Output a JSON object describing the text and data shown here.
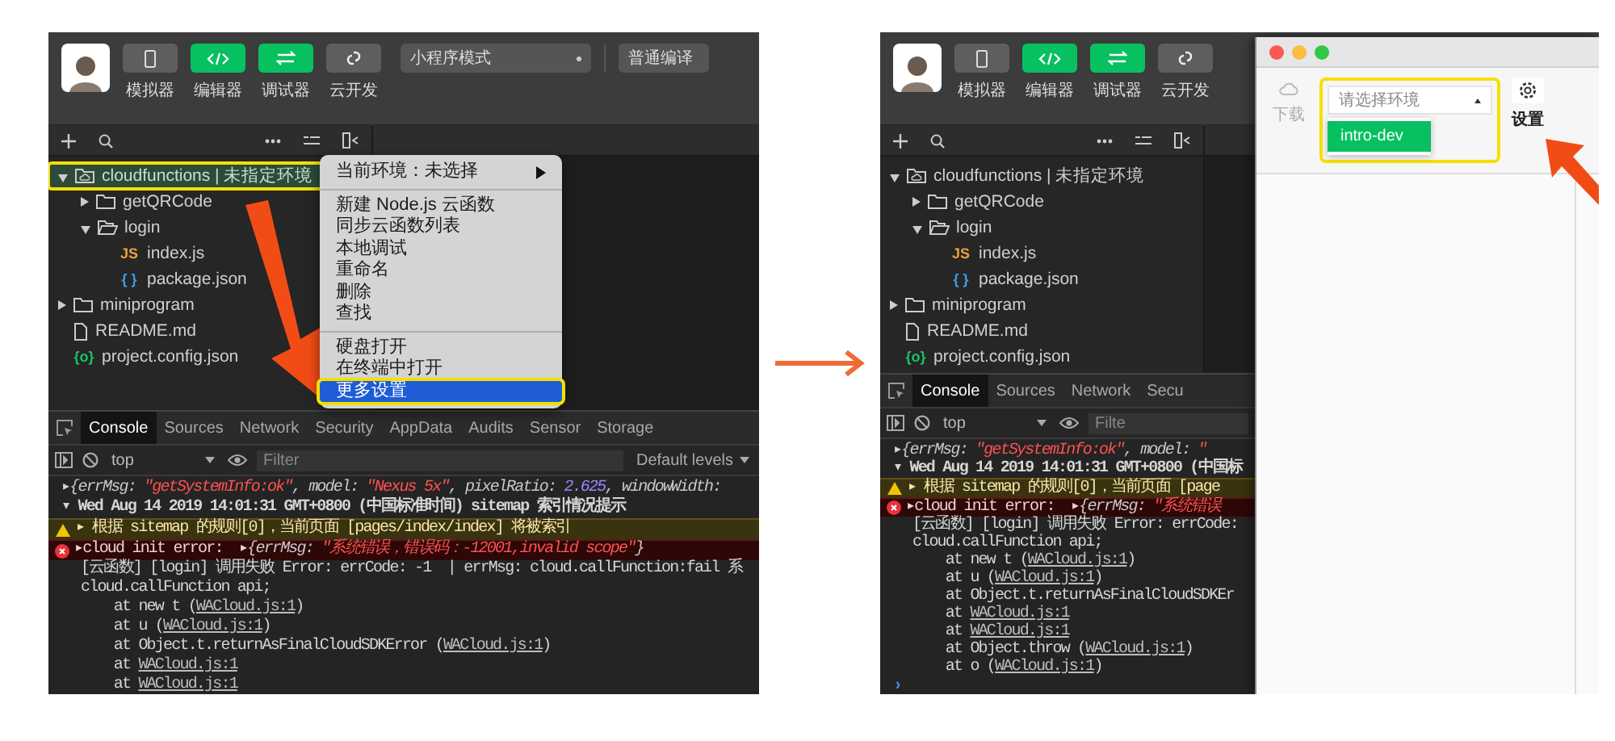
{
  "left_screen": {
    "toolbar": {
      "tools": [
        {
          "label": "模拟器",
          "selected": false
        },
        {
          "label": "编辑器",
          "selected": true
        },
        {
          "label": "调试器",
          "selected": true
        },
        {
          "label": "云开发",
          "selected": false
        }
      ],
      "mode_select": "小程序模式",
      "compile_select": "普通编译"
    },
    "file_tree": [
      {
        "name": "cloudfunctions | 未指定环境",
        "kind": "cloud-folder",
        "expanded": true,
        "selected": true,
        "highlighted": true,
        "children": [
          {
            "name": "getQRCode",
            "kind": "folder",
            "expanded": false,
            "selected": false,
            "highlighted": false
          },
          {
            "name": "login",
            "kind": "folder",
            "expanded": true,
            "selected": false,
            "highlighted": false,
            "children": [
              {
                "name": "index.js",
                "kind": "js",
                "badge": "JS",
                "selected": false,
                "highlighted": false
              },
              {
                "name": "package.json",
                "kind": "json",
                "badge": "{ }",
                "selected": false,
                "highlighted": false
              }
            ]
          }
        ]
      },
      {
        "name": "miniprogram",
        "kind": "folder",
        "expanded": false,
        "selected": false,
        "highlighted": false
      },
      {
        "name": "README.md",
        "kind": "file",
        "selected": false,
        "highlighted": false
      },
      {
        "name": "project.config.json",
        "kind": "config",
        "badge": "{o}",
        "selected": false,
        "highlighted": false
      }
    ],
    "context_menu": {
      "groups": [
        [
          {
            "label": "当前环境：未选择",
            "submenu": true,
            "selected": false,
            "highlighted": false
          }
        ],
        [
          {
            "label": "新建 Node.js 云函数",
            "submenu": false,
            "selected": false,
            "highlighted": false
          },
          {
            "label": "同步云函数列表",
            "submenu": false,
            "selected": false,
            "highlighted": false
          },
          {
            "label": "本地调试",
            "submenu": false,
            "selected": false,
            "highlighted": false
          },
          {
            "label": "重命名",
            "submenu": false,
            "selected": false,
            "highlighted": false
          },
          {
            "label": "删除",
            "submenu": false,
            "selected": false,
            "highlighted": false
          },
          {
            "label": "查找",
            "submenu": false,
            "selected": false,
            "highlighted": false
          }
        ],
        [
          {
            "label": "硬盘打开",
            "submenu": false,
            "selected": false,
            "highlighted": false
          },
          {
            "label": "在终端中打开",
            "submenu": false,
            "selected": false,
            "highlighted": false
          },
          {
            "label": "更多设置",
            "submenu": false,
            "selected": true,
            "highlighted": true
          }
        ]
      ]
    },
    "devtools": {
      "tabs": [
        {
          "label": "Console",
          "selected": true
        },
        {
          "label": "Sources",
          "selected": false
        },
        {
          "label": "Network",
          "selected": false
        },
        {
          "label": "Security",
          "selected": false
        },
        {
          "label": "AppData",
          "selected": false
        },
        {
          "label": "Audits",
          "selected": false
        },
        {
          "label": "Sensor",
          "selected": false
        },
        {
          "label": "Storage",
          "selected": false
        }
      ],
      "context": "top",
      "filter_placeholder": "Filter",
      "levels": "Default levels",
      "console": [
        {
          "kind": "log",
          "parts": [
            {
              "text": "▸",
              "kind": "plain"
            },
            {
              "text": "{errMsg: ",
              "kind": "italic"
            },
            {
              "text": "\"getSystemInfo:ok\"",
              "kind": "string"
            },
            {
              "text": ", model: ",
              "kind": "italic"
            },
            {
              "text": "\"Nexus 5x\"",
              "kind": "string"
            },
            {
              "text": ", pixelRatio: ",
              "kind": "italic"
            },
            {
              "text": "2.625",
              "kind": "number"
            },
            {
              "text": ", windowWidth:",
              "kind": "italic"
            }
          ]
        },
        {
          "kind": "group",
          "parts": [
            {
              "text": "▾ Wed Aug 14 2019 14:01:31 GMT+0800 (中国标准时间) sitemap 索引情况提示",
              "kind": "plain"
            }
          ]
        },
        {
          "kind": "warning",
          "parts": [
            {
              "text": "▸ 根据 sitemap 的规则[0]，当前页面 [pages/index/index] 将被索引",
              "kind": "plain"
            }
          ]
        },
        {
          "kind": "error",
          "parts": [
            {
              "text": "▸cloud init error:  ▸",
              "kind": "plain"
            },
            {
              "text": "{errMsg: ",
              "kind": "italic"
            },
            {
              "text": "\"系统错误，错误码：-12001,invalid scope\"",
              "kind": "string"
            },
            {
              "text": "}",
              "kind": "italic"
            }
          ]
        },
        {
          "kind": "trace",
          "parts": [
            {
              "text": "[云函数] [login] 调用失败 Error: errCode: -1  | errMsg: cloud.callFunction:fail 系",
              "kind": "plain"
            }
          ]
        },
        {
          "kind": "trace",
          "parts": [
            {
              "text": "cloud.callFunction api;",
              "kind": "plain"
            }
          ]
        },
        {
          "kind": "trace",
          "parts": [
            {
              "text": "    at new t (",
              "kind": "plain"
            },
            {
              "text": "WACloud.js:1",
              "kind": "link"
            },
            {
              "text": ")",
              "kind": "plain"
            }
          ]
        },
        {
          "kind": "trace",
          "parts": [
            {
              "text": "    at u (",
              "kind": "plain"
            },
            {
              "text": "WACloud.js:1",
              "kind": "link"
            },
            {
              "text": ")",
              "kind": "plain"
            }
          ]
        },
        {
          "kind": "trace",
          "parts": [
            {
              "text": "    at Object.t.returnAsFinalCloudSDKError (",
              "kind": "plain"
            },
            {
              "text": "WACloud.js:1",
              "kind": "link"
            },
            {
              "text": ")",
              "kind": "plain"
            }
          ]
        },
        {
          "kind": "trace",
          "parts": [
            {
              "text": "    at ",
              "kind": "plain"
            },
            {
              "text": "WACloud.js:1",
              "kind": "link"
            }
          ]
        },
        {
          "kind": "trace",
          "parts": [
            {
              "text": "    at ",
              "kind": "plain"
            },
            {
              "text": "WACloud.js:1",
              "kind": "link"
            }
          ]
        }
      ]
    }
  },
  "right_screen": {
    "toolbar": {
      "tools": [
        {
          "label": "模拟器",
          "selected": false
        },
        {
          "label": "编辑器",
          "selected": true
        },
        {
          "label": "调试器",
          "selected": true
        },
        {
          "label": "云开发",
          "selected": false
        }
      ]
    },
    "file_tree": [
      {
        "name": "cloudfunctions | 未指定环境",
        "kind": "cloud-folder",
        "expanded": true,
        "selected": false,
        "highlighted": false,
        "children": [
          {
            "name": "getQRCode",
            "kind": "folder",
            "expanded": false,
            "selected": false,
            "highlighted": false
          },
          {
            "name": "login",
            "kind": "folder",
            "expanded": true,
            "selected": false,
            "highlighted": false,
            "children": [
              {
                "name": "index.js",
                "kind": "js",
                "badge": "JS",
                "selected": false,
                "highlighted": false
              },
              {
                "name": "package.json",
                "kind": "json",
                "badge": "{ }",
                "selected": false,
                "highlighted": false
              }
            ]
          }
        ]
      },
      {
        "name": "miniprogram",
        "kind": "folder",
        "expanded": false,
        "selected": false,
        "highlighted": false
      },
      {
        "name": "README.md",
        "kind": "file",
        "selected": false,
        "highlighted": false
      },
      {
        "name": "project.config.json",
        "kind": "config",
        "badge": "{o}",
        "selected": false,
        "highlighted": false
      }
    ],
    "devtools": {
      "tabs": [
        {
          "label": "Console",
          "selected": true
        },
        {
          "label": "Sources",
          "selected": false
        },
        {
          "label": "Network",
          "selected": false
        },
        {
          "label": "Secu",
          "selected": false
        }
      ],
      "context": "top",
      "filter_placeholder": "Filte",
      "console": [
        {
          "kind": "log",
          "parts": [
            {
              "text": "▸",
              "kind": "plain"
            },
            {
              "text": "{errMsg: ",
              "kind": "italic"
            },
            {
              "text": "\"getSystemInfo:ok\"",
              "kind": "string"
            },
            {
              "text": ", model: ",
              "kind": "italic"
            },
            {
              "text": "\"",
              "kind": "string"
            }
          ]
        },
        {
          "kind": "group",
          "parts": [
            {
              "text": "▾ Wed Aug 14 2019 14:01:31 GMT+0800 (中国标",
              "kind": "plain"
            }
          ]
        },
        {
          "kind": "warning",
          "parts": [
            {
              "text": "▸ 根据 sitemap 的规则[0]，当前页面 [page",
              "kind": "plain"
            }
          ]
        },
        {
          "kind": "error",
          "parts": [
            {
              "text": "▸cloud init error:  ▸",
              "kind": "plain"
            },
            {
              "text": "{errMsg: ",
              "kind": "italic"
            },
            {
              "text": "\"系统错误",
              "kind": "string"
            }
          ]
        },
        {
          "kind": "trace",
          "parts": [
            {
              "text": "[云函数] [login] 调用失败 Error: errCode:",
              "kind": "plain"
            }
          ]
        },
        {
          "kind": "trace",
          "parts": [
            {
              "text": "cloud.callFunction api;",
              "kind": "plain"
            }
          ]
        },
        {
          "kind": "trace",
          "parts": [
            {
              "text": "    at new t (",
              "kind": "plain"
            },
            {
              "text": "WACloud.js:1",
              "kind": "link"
            },
            {
              "text": ")",
              "kind": "plain"
            }
          ]
        },
        {
          "kind": "trace",
          "parts": [
            {
              "text": "    at u (",
              "kind": "plain"
            },
            {
              "text": "WACloud.js:1",
              "kind": "link"
            },
            {
              "text": ")",
              "kind": "plain"
            }
          ]
        },
        {
          "kind": "trace",
          "parts": [
            {
              "text": "    at Object.t.returnAsFinalCloudSDKEr",
              "kind": "plain"
            }
          ]
        },
        {
          "kind": "trace",
          "parts": [
            {
              "text": "    at ",
              "kind": "plain"
            },
            {
              "text": "WACloud.js:1",
              "kind": "link"
            }
          ]
        },
        {
          "kind": "trace",
          "parts": [
            {
              "text": "    at ",
              "kind": "plain"
            },
            {
              "text": "WACloud.js:1",
              "kind": "link"
            }
          ]
        },
        {
          "kind": "trace",
          "parts": [
            {
              "text": "    at Object.throw (",
              "kind": "plain"
            },
            {
              "text": "WACloud.js:1",
              "kind": "link"
            },
            {
              "text": ")",
              "kind": "plain"
            }
          ]
        },
        {
          "kind": "trace",
          "parts": [
            {
              "text": "    at o (",
              "kind": "plain"
            },
            {
              "text": "WACloud.js:1",
              "kind": "link"
            },
            {
              "text": ")",
              "kind": "plain"
            }
          ]
        },
        {
          "kind": "prompt",
          "parts": [
            {
              "text": "›",
              "kind": "prompt"
            }
          ]
        }
      ]
    },
    "env_dialog": {
      "download": {
        "label": "下载",
        "disabled": true
      },
      "env_select": {
        "placeholder": "请选择环境",
        "highlighted": true,
        "options": [
          {
            "label": "intro-dev",
            "selected": true
          }
        ]
      },
      "settings": "设置"
    }
  }
}
